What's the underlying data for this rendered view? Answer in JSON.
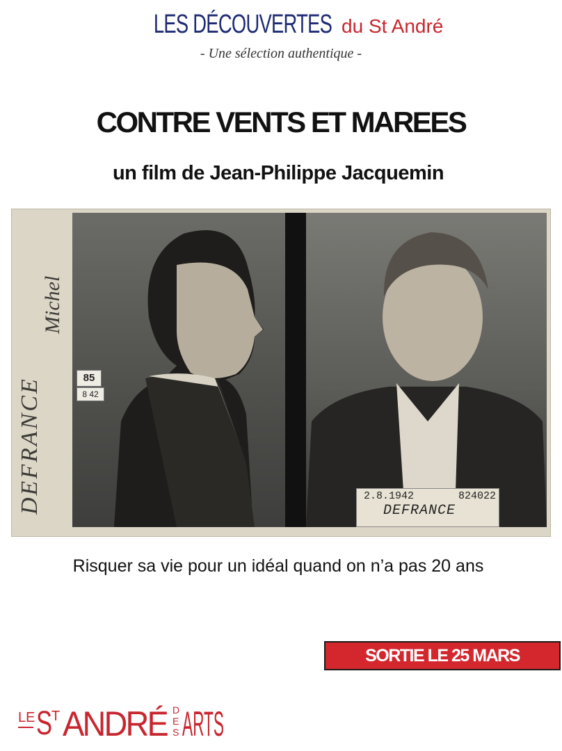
{
  "header": {
    "series_main": "LES DÉCOUVERTES",
    "series_sub": "du St André",
    "series_tagline": "- Une sélection authentique -"
  },
  "film": {
    "title": "CONTRE VENTS ET MAREES",
    "credit": "un film de Jean-Philippe Jacquemin",
    "tagline": "Risquer sa vie pour un idéal quand on n’a pas 20 ans",
    "release": "SORTIE LE 25 MARS"
  },
  "photo": {
    "handwritten_surname": "DEFRANCE",
    "handwritten_firstname": "Michel",
    "tag_number": "85",
    "tag_date": "8 42",
    "placard_date": "2.8.1942",
    "placard_number": "824022",
    "placard_name": "DEFRANCE"
  },
  "footer": {
    "logo_text": "LE ST ANDRÉ DES ARTS"
  },
  "colors": {
    "navy": "#1d2a73",
    "red": "#c8262e",
    "banner_red": "#d3262d"
  }
}
